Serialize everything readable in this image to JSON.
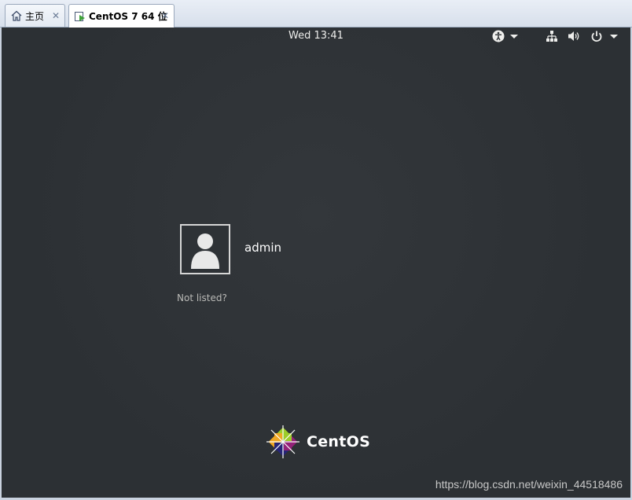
{
  "tabs": [
    {
      "label": "主页",
      "icon": "home-icon",
      "active": false
    },
    {
      "label": "CentOS 7 64 位",
      "icon": "vm-icon",
      "active": true
    }
  ],
  "topbar": {
    "clock": "Wed 13:41",
    "icons": [
      "accessibility-icon",
      "network-icon",
      "volume-icon",
      "power-icon"
    ]
  },
  "login": {
    "user_name": "admin",
    "not_listed": "Not listed?"
  },
  "brand": {
    "text": "CentOS"
  },
  "watermark": "https://blog.csdn.net/weixin_44518486",
  "colors": {
    "background": "#2e3236",
    "text": "#eeeeec"
  }
}
